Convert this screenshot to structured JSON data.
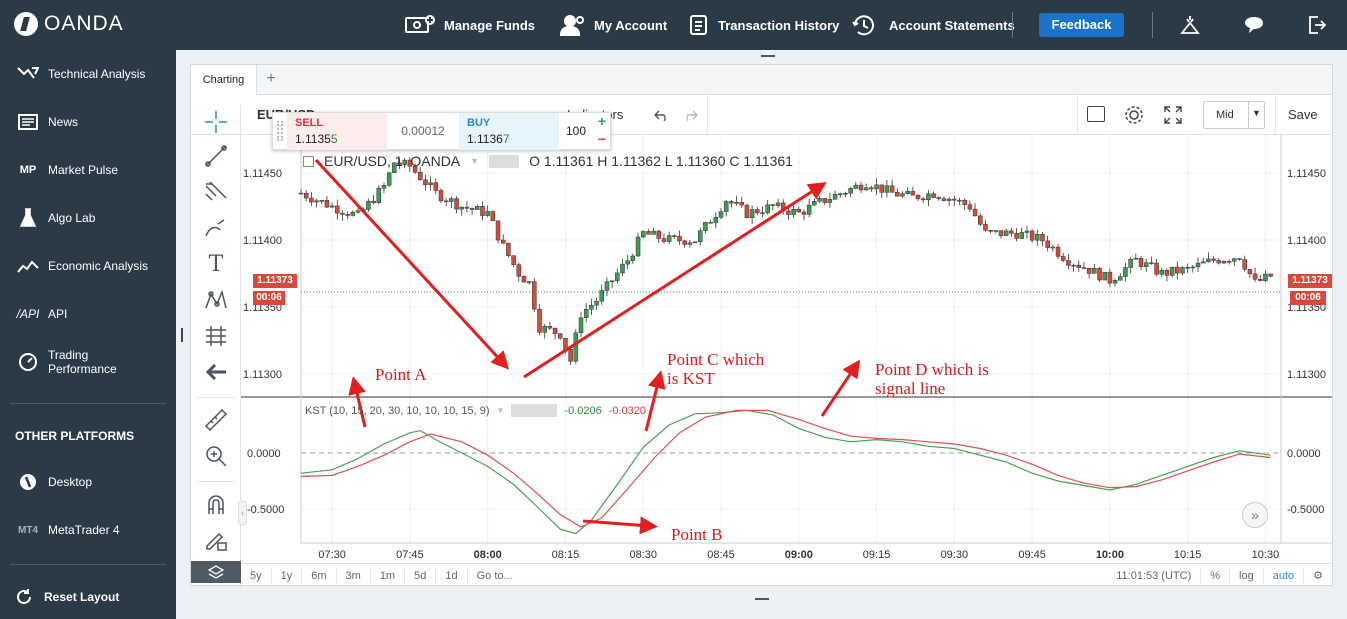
{
  "topbar": {
    "logo": "OANDA",
    "manage_funds": "Manage Funds",
    "my_account": "My Account",
    "transaction_history": "Transaction History",
    "account_statements": "Account Statements",
    "feedback": "Feedback"
  },
  "sidebar": {
    "items": [
      {
        "label": "Technical Analysis",
        "icon": "technical-analysis-icon"
      },
      {
        "label": "News",
        "icon": "news-icon"
      },
      {
        "label": "Market Pulse",
        "icon": "market-pulse-icon"
      },
      {
        "label": "Algo Lab",
        "icon": "flask-icon"
      },
      {
        "label": "Economic Analysis",
        "icon": "economic-analysis-icon"
      },
      {
        "label": "API",
        "icon": "api-icon"
      },
      {
        "label": "Trading\nPerformance",
        "icon": "gauge-icon"
      }
    ],
    "other_heading": "OTHER PLATFORMS",
    "platforms": [
      {
        "label": "Desktop",
        "icon": "oanda-desktop-icon"
      },
      {
        "label": "MetaTrader 4",
        "icon": "mt4-icon",
        "badge": "MT4"
      }
    ],
    "reset": "Reset Layout"
  },
  "tabs": {
    "charting": "Charting",
    "add": "+"
  },
  "toolbar": {
    "symbol": "EUR/USD",
    "indicators": "Indicators",
    "price_type": "Mid",
    "save": "Save"
  },
  "trade": {
    "sell_label": "SELL",
    "sell_price": "1.1135",
    "sell_pip": "5",
    "spread": "0.00012",
    "buy_label": "BUY",
    "buy_price": "1.1136",
    "buy_pip": "7",
    "units": "100",
    "plus": "+",
    "minus": "−"
  },
  "legend": {
    "title": "EUR/USD, 1, OANDA",
    "ohlc": "O 1.11361  H 1.11362  L 1.11360  C 1.11361",
    "kst": "KST (10, 15, 20, 30, 10, 10, 10, 15, 9)",
    "kst_value": "-0.0206",
    "signal_value": "-0.0320"
  },
  "price_badges": {
    "price": "1.11373",
    "countdown": "00:06"
  },
  "annotations": {
    "point_a": "Point A",
    "point_b": "Point B",
    "point_c": "Point C which\nis KST",
    "point_d": "Point D which is\nsignal line"
  },
  "bottombar": {
    "ranges": [
      "5y",
      "1y",
      "6m",
      "3m",
      "1m",
      "5d",
      "1d",
      "Go to..."
    ],
    "time": "11:01:53 (UTC)",
    "percent": "%",
    "log": "log",
    "auto": "auto"
  },
  "colors": {
    "bull": "#3f9b52",
    "bear": "#d64a3c",
    "signal": "#e05050",
    "kst": "#4aa14e",
    "accent": "#1a73c9"
  },
  "chart_data": [
    {
      "type": "candlestick",
      "title": "EUR/USD, 1, OANDA",
      "ylim": [
        1.1128,
        1.1147
      ],
      "y_ticks": [
        "1.11450",
        "1.11400",
        "1.11350",
        "1.11300"
      ],
      "x_ticks": [
        "07:30",
        "07:45",
        "08:00",
        "08:15",
        "08:30",
        "08:45",
        "09:00",
        "09:15",
        "09:30",
        "09:45",
        "10:00",
        "10:15",
        "10:30"
      ],
      "close_path": [
        [
          "07:24",
          1.11435
        ],
        [
          "07:30",
          1.11425
        ],
        [
          "07:35",
          1.11418
        ],
        [
          "07:40",
          1.1144
        ],
        [
          "07:42",
          1.11458
        ],
        [
          "07:45",
          1.11455
        ],
        [
          "07:50",
          1.11435
        ],
        [
          "07:55",
          1.11425
        ],
        [
          "08:00",
          1.1142
        ],
        [
          "08:03",
          1.11395
        ],
        [
          "08:06",
          1.11375
        ],
        [
          "08:08",
          1.11368
        ],
        [
          "08:10",
          1.11335
        ],
        [
          "08:14",
          1.1133
        ],
        [
          "08:16",
          1.1131
        ],
        [
          "08:18",
          1.11345
        ],
        [
          "08:21",
          1.11355
        ],
        [
          "08:24",
          1.1137
        ],
        [
          "08:27",
          1.11385
        ],
        [
          "08:30",
          1.11405
        ],
        [
          "08:35",
          1.114
        ],
        [
          "08:40",
          1.114
        ],
        [
          "08:43",
          1.11415
        ],
        [
          "08:46",
          1.1143
        ],
        [
          "08:50",
          1.1142
        ],
        [
          "08:55",
          1.11425
        ],
        [
          "09:00",
          1.1142
        ],
        [
          "09:05",
          1.1143
        ],
        [
          "09:10",
          1.11438
        ],
        [
          "09:13",
          1.11443
        ],
        [
          "09:18",
          1.11435
        ],
        [
          "09:22",
          1.11432
        ],
        [
          "09:26",
          1.11435
        ],
        [
          "09:30",
          1.1143
        ],
        [
          "09:33",
          1.11425
        ],
        [
          "09:36",
          1.11405
        ],
        [
          "09:42",
          1.11405
        ],
        [
          "09:47",
          1.114
        ],
        [
          "09:52",
          1.11385
        ],
        [
          "09:56",
          1.11378
        ],
        [
          "10:00",
          1.1137
        ],
        [
          "10:05",
          1.11385
        ],
        [
          "10:10",
          1.11375
        ],
        [
          "10:15",
          1.11378
        ],
        [
          "10:20",
          1.11385
        ],
        [
          "10:25",
          1.11388
        ],
        [
          "10:28",
          1.11368
        ],
        [
          "10:31",
          1.11373
        ]
      ],
      "current_price": 1.11373
    },
    {
      "type": "line",
      "title": "KST (10, 15, 20, 30, 10, 10, 10, 15, 9)",
      "ylim": [
        -0.7,
        0.4
      ],
      "y_ticks": [
        "0.0000",
        "-0.5000"
      ],
      "series": [
        {
          "name": "KST",
          "values": [
            [
              "07:24",
              -0.18
            ],
            [
              "07:30",
              -0.15
            ],
            [
              "07:35",
              -0.05
            ],
            [
              "07:40",
              0.08
            ],
            [
              "07:45",
              0.18
            ],
            [
              "07:47",
              0.2
            ],
            [
              "07:50",
              0.12
            ],
            [
              "07:55",
              0.0
            ],
            [
              "08:00",
              -0.12
            ],
            [
              "08:05",
              -0.28
            ],
            [
              "08:10",
              -0.5
            ],
            [
              "08:14",
              -0.68
            ],
            [
              "08:17",
              -0.72
            ],
            [
              "08:20",
              -0.6
            ],
            [
              "08:25",
              -0.28
            ],
            [
              "08:30",
              0.05
            ],
            [
              "08:35",
              0.25
            ],
            [
              "08:40",
              0.35
            ],
            [
              "08:45",
              0.36
            ],
            [
              "08:50",
              0.38
            ],
            [
              "08:55",
              0.34
            ],
            [
              "09:00",
              0.22
            ],
            [
              "09:05",
              0.14
            ],
            [
              "09:10",
              0.1
            ],
            [
              "09:15",
              0.12
            ],
            [
              "09:20",
              0.1
            ],
            [
              "09:25",
              0.06
            ],
            [
              "09:30",
              0.04
            ],
            [
              "09:35",
              -0.02
            ],
            [
              "09:40",
              -0.08
            ],
            [
              "09:45",
              -0.18
            ],
            [
              "09:50",
              -0.25
            ],
            [
              "09:55",
              -0.29
            ],
            [
              "10:00",
              -0.33
            ],
            [
              "10:05",
              -0.28
            ],
            [
              "10:10",
              -0.2
            ],
            [
              "10:15",
              -0.12
            ],
            [
              "10:20",
              -0.04
            ],
            [
              "10:25",
              0.02
            ],
            [
              "10:31",
              -0.02
            ]
          ]
        },
        {
          "name": "Signal",
          "values": [
            [
              "07:24",
              -0.21
            ],
            [
              "07:30",
              -0.2
            ],
            [
              "07:35",
              -0.12
            ],
            [
              "07:40",
              -0.02
            ],
            [
              "07:45",
              0.1
            ],
            [
              "07:49",
              0.17
            ],
            [
              "07:55",
              0.1
            ],
            [
              "08:00",
              -0.02
            ],
            [
              "08:05",
              -0.18
            ],
            [
              "08:10",
              -0.38
            ],
            [
              "08:14",
              -0.55
            ],
            [
              "08:18",
              -0.66
            ],
            [
              "08:22",
              -0.58
            ],
            [
              "08:27",
              -0.32
            ],
            [
              "08:32",
              -0.05
            ],
            [
              "08:37",
              0.18
            ],
            [
              "08:42",
              0.32
            ],
            [
              "08:48",
              0.38
            ],
            [
              "08:54",
              0.38
            ],
            [
              "09:00",
              0.3
            ],
            [
              "09:05",
              0.22
            ],
            [
              "09:10",
              0.15
            ],
            [
              "09:15",
              0.13
            ],
            [
              "09:20",
              0.12
            ],
            [
              "09:25",
              0.1
            ],
            [
              "09:30",
              0.08
            ],
            [
              "09:35",
              0.04
            ],
            [
              "09:40",
              -0.02
            ],
            [
              "09:45",
              -0.1
            ],
            [
              "09:50",
              -0.2
            ],
            [
              "09:55",
              -0.27
            ],
            [
              "10:00",
              -0.31
            ],
            [
              "10:05",
              -0.3
            ],
            [
              "10:10",
              -0.24
            ],
            [
              "10:15",
              -0.16
            ],
            [
              "10:20",
              -0.08
            ],
            [
              "10:25",
              -0.01
            ],
            [
              "10:31",
              -0.04
            ]
          ]
        }
      ]
    }
  ]
}
